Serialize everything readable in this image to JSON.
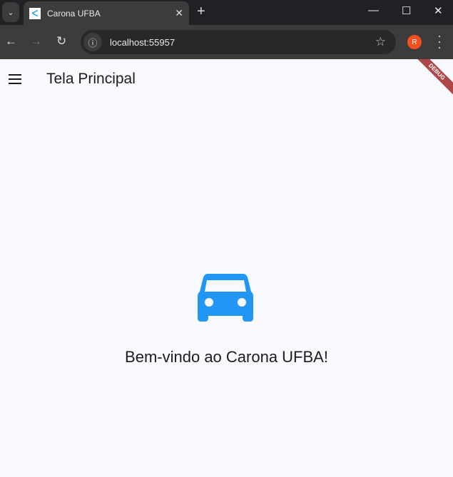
{
  "browser": {
    "tab_title": "Carona UFBA",
    "url": "localhost:55957",
    "profile_initial": "R"
  },
  "app": {
    "title": "Tela Principal",
    "debug_banner": "DEBUG",
    "welcome": "Bem-vindo ao Carona UFBA!",
    "accent": "#2196f3"
  }
}
